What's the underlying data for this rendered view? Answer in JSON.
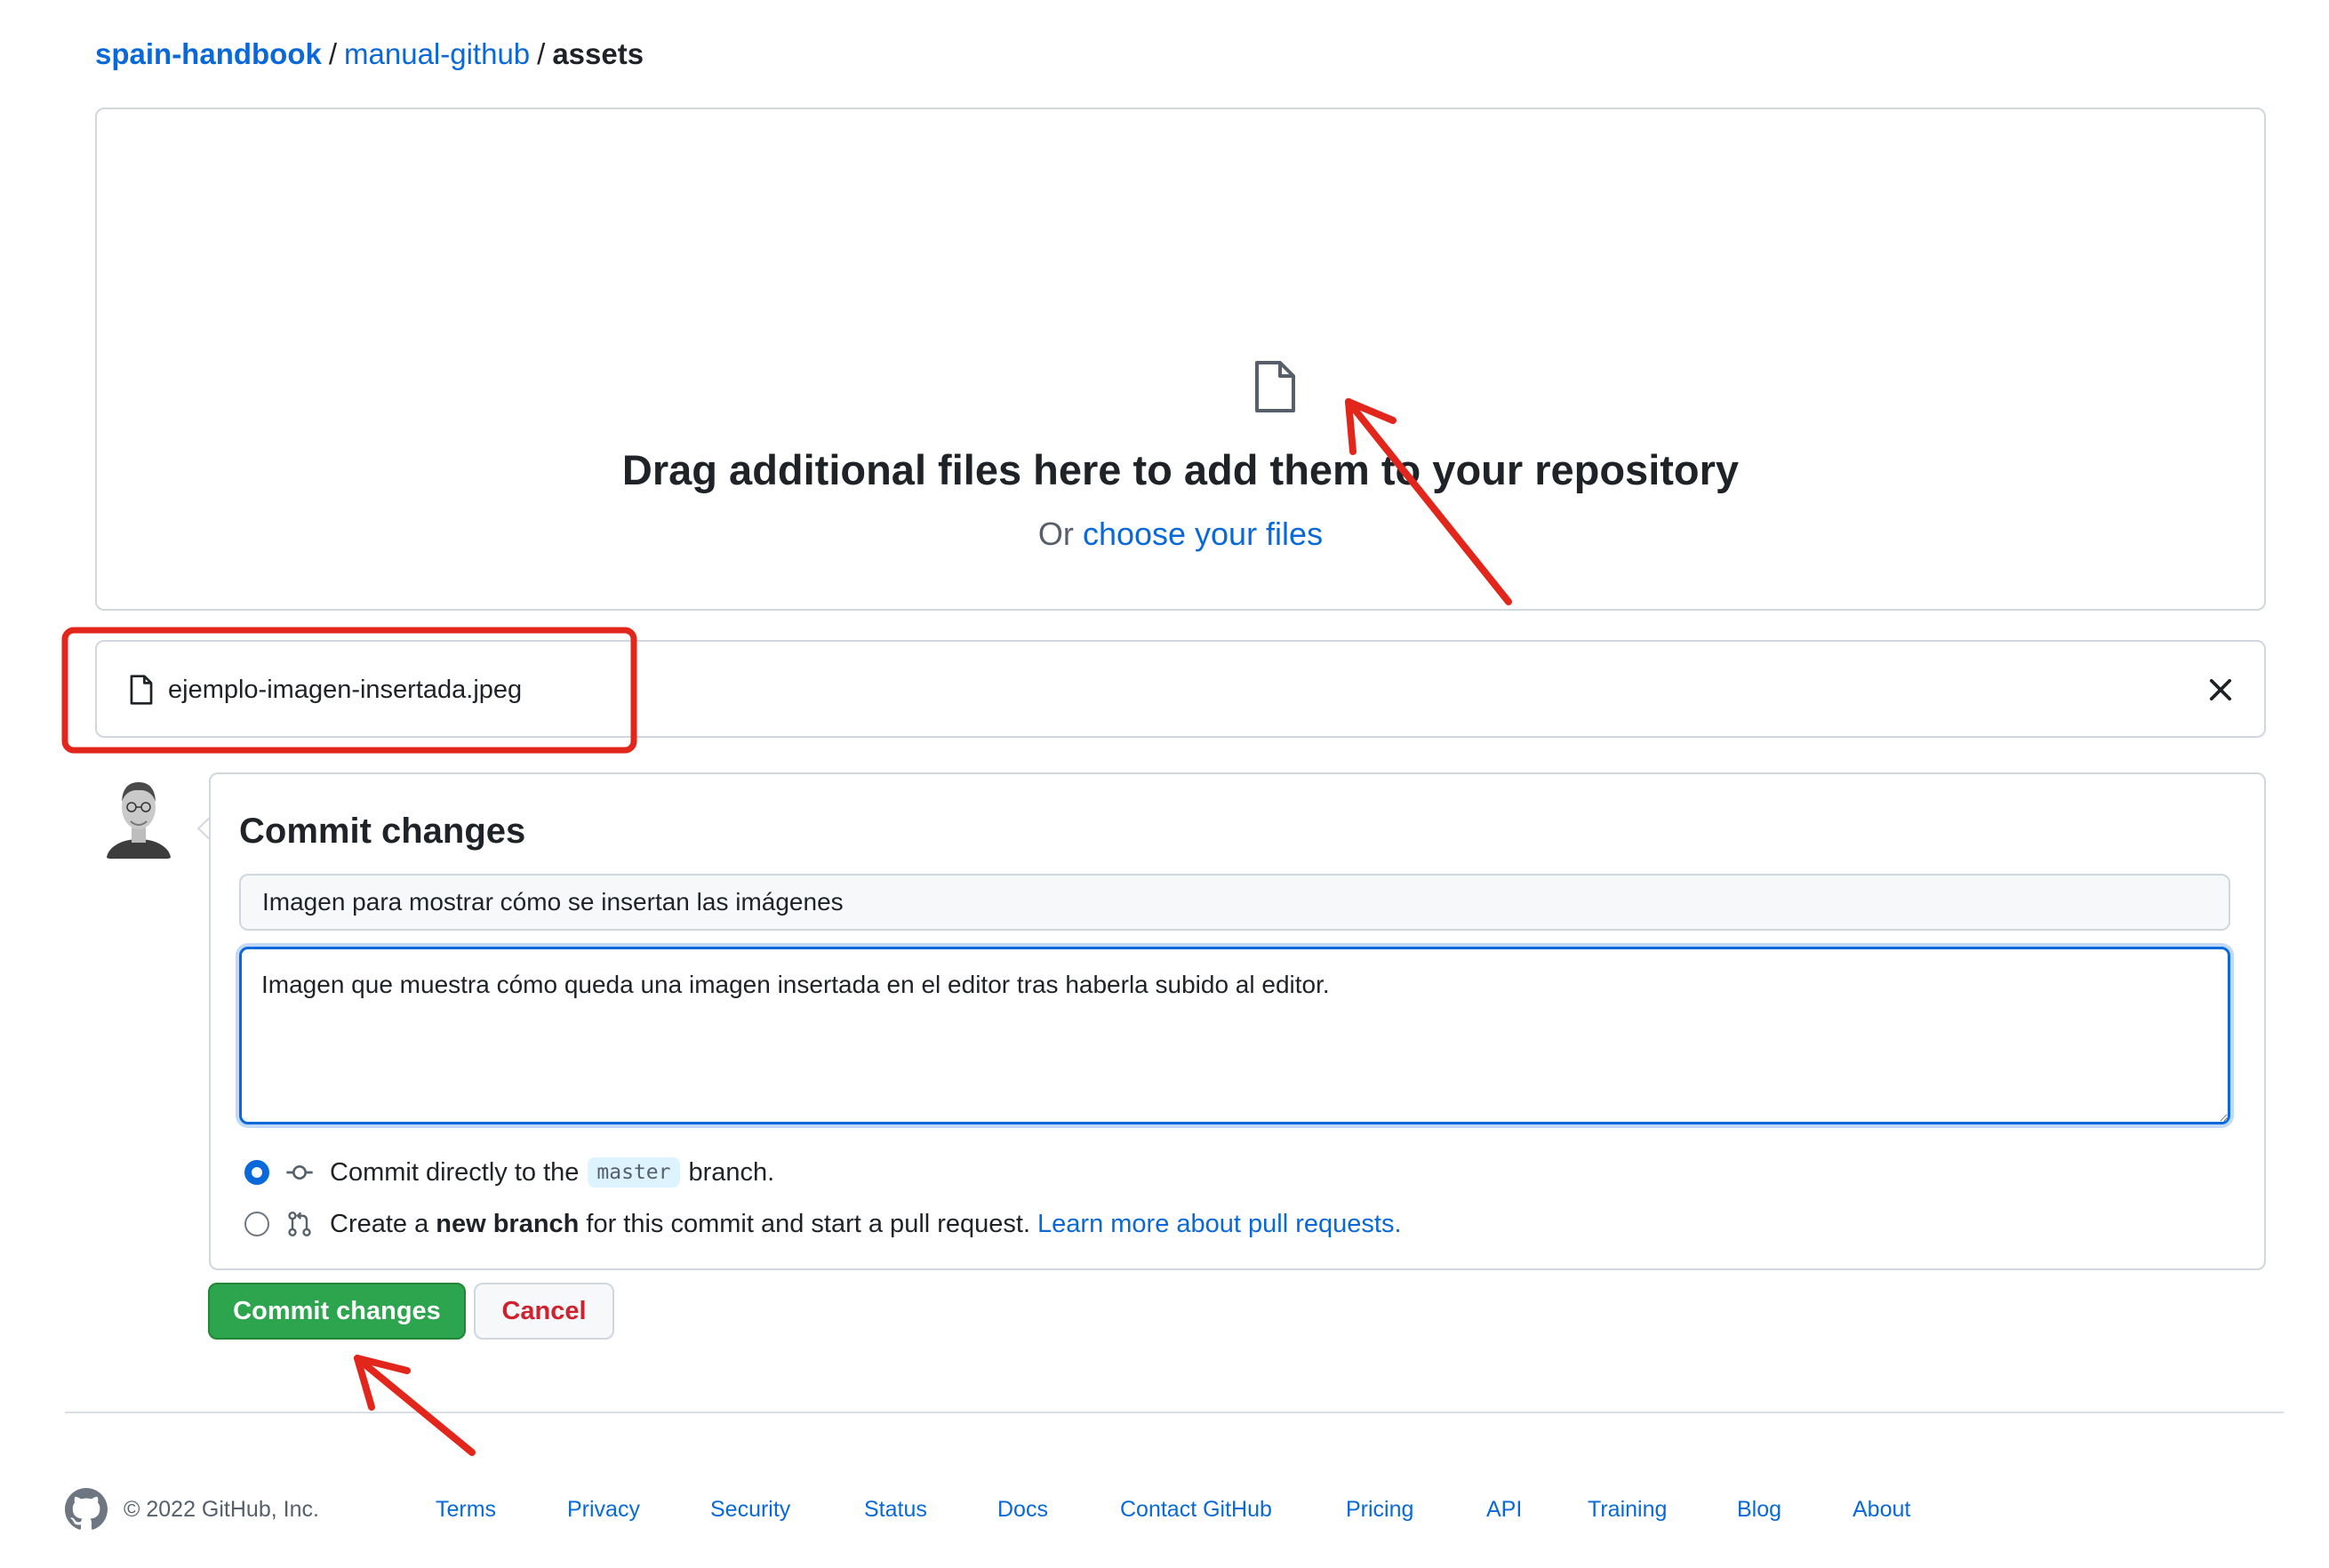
{
  "breadcrumb": {
    "owner": "spain-handbook",
    "sep1": "/",
    "repo": "manual-github",
    "sep2": "/",
    "current": "assets"
  },
  "dropzone": {
    "icon": "file-icon",
    "title": "Drag additional files here to add them to your repository",
    "prefix": "Or",
    "link": "choose your files"
  },
  "file": {
    "icon": "file-icon",
    "name": "ejemplo-imagen-insertada.jpeg",
    "remove_icon": "x-icon"
  },
  "commit": {
    "title": "Commit changes",
    "summary_value": "Imagen para mostrar cómo se insertan las imágenes",
    "description_value": "Imagen que muestra cómo queda una imagen insertada en el editor tras haberla subido al editor.",
    "option_direct": {
      "icon": "git-commit-icon",
      "before": "Commit directly to the",
      "branch": "master",
      "after": "branch.",
      "checked": true
    },
    "option_new": {
      "icon": "git-pull-request-icon",
      "before": "Create a",
      "bold": "new branch",
      "after": "for this commit and start a pull request.",
      "link": "Learn more about pull requests.",
      "checked": false
    },
    "submit_label": "Commit changes",
    "cancel_label": "Cancel"
  },
  "footer": {
    "logo": "github-mark-icon",
    "copyright": "© 2022 GitHub, Inc.",
    "links": [
      "Terms",
      "Privacy",
      "Security",
      "Status",
      "Docs",
      "Contact GitHub",
      "Pricing",
      "API",
      "Training",
      "Blog",
      "About"
    ]
  },
  "colors": {
    "link": "#0969da",
    "primary_button": "#2da44e",
    "cancel_text": "#cf222e",
    "annotation": "#e3261b"
  }
}
